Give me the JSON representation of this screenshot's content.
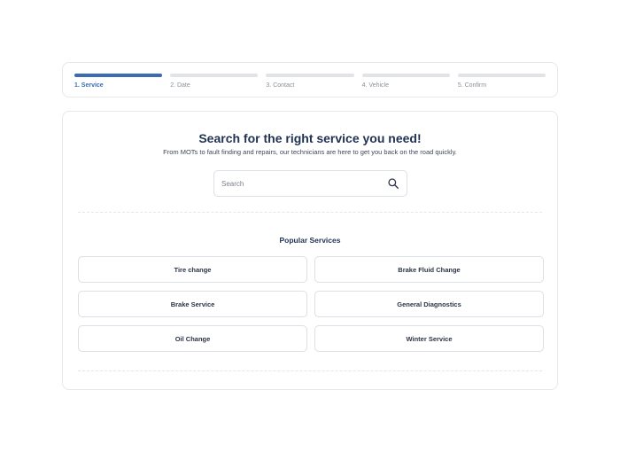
{
  "stepper": {
    "steps": [
      {
        "label": "1. Service",
        "active": true
      },
      {
        "label": "2. Date",
        "active": false
      },
      {
        "label": "3. Contact",
        "active": false
      },
      {
        "label": "4. Vehicle",
        "active": false
      },
      {
        "label": "5. Confirm",
        "active": false
      }
    ]
  },
  "main": {
    "title": "Search for the right service you need!",
    "subtitle": "From MOTs to fault finding and repairs, our technicians are here to get you back on the road quickly.",
    "search": {
      "placeholder": "Search",
      "value": "",
      "icon": "search-icon"
    },
    "popular_title": "Popular Services",
    "services": [
      "Tire change",
      "Brake Fluid Change",
      "Brake Service",
      "General Diagnostics",
      "Oil Change",
      "Winter Service"
    ]
  },
  "colors": {
    "accent": "#3a6bb3",
    "title": "#1f3252",
    "border": "#e6e8ec",
    "inactive_bar": "#e1e3e7"
  }
}
